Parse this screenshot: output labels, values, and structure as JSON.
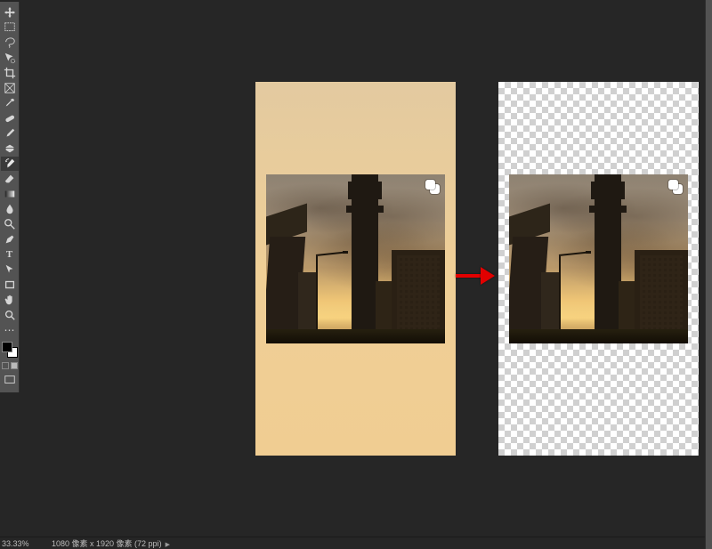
{
  "status": {
    "zoom": "33.33%",
    "doc_info": "1080 像素 x 1920 像素 (72 ppi)"
  },
  "tools": {
    "items": [
      {
        "name": "move",
        "glyph": "move"
      },
      {
        "name": "marquee",
        "glyph": "marquee"
      },
      {
        "name": "lasso",
        "glyph": "lasso"
      },
      {
        "name": "quick-select",
        "glyph": "wand-area",
        "selected": false
      },
      {
        "name": "crop",
        "glyph": "crop"
      },
      {
        "name": "frame",
        "glyph": "frame"
      },
      {
        "name": "eyedropper",
        "glyph": "eyedropper"
      },
      {
        "name": "healing-brush",
        "glyph": "bandaid"
      },
      {
        "name": "brush",
        "glyph": "brush"
      },
      {
        "name": "clone-stamp",
        "glyph": "stamp"
      },
      {
        "name": "history-brush",
        "glyph": "history-brush",
        "selected": true
      },
      {
        "name": "eraser",
        "glyph": "eraser"
      },
      {
        "name": "gradient",
        "glyph": "gradient"
      },
      {
        "name": "blur",
        "glyph": "drop"
      },
      {
        "name": "dodge",
        "glyph": "lolly"
      },
      {
        "name": "pen",
        "glyph": "pen"
      },
      {
        "name": "type",
        "glyph": "T"
      },
      {
        "name": "path-select",
        "glyph": "arrow"
      },
      {
        "name": "rectangle",
        "glyph": "rect"
      },
      {
        "name": "hand",
        "glyph": "hand"
      },
      {
        "name": "zoom",
        "glyph": "zoom"
      }
    ]
  },
  "colors": {
    "foreground": "#000000",
    "background": "#ffffff"
  }
}
